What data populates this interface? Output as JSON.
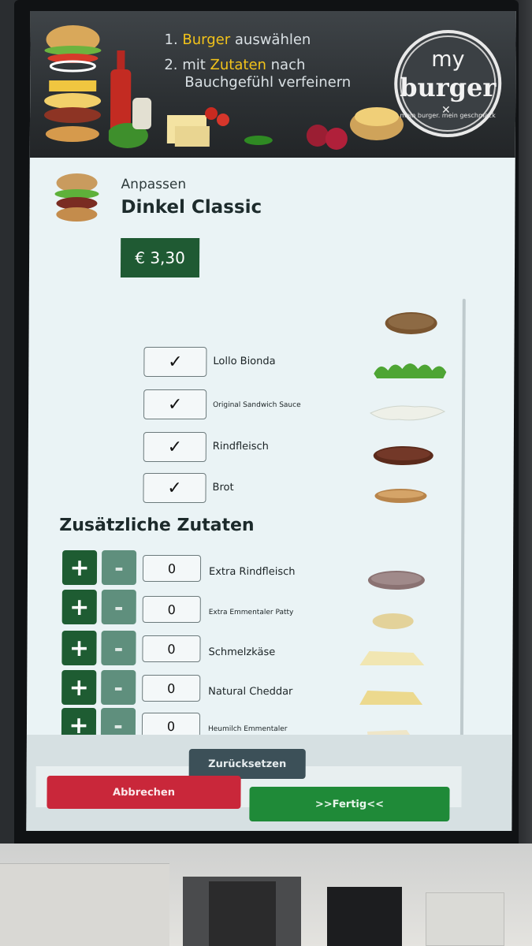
{
  "banner": {
    "step1_prefix": "1. ",
    "step1_highlight": "Burger",
    "step1_suffix": " auswählen",
    "step2_prefix": "2. mit ",
    "step2_highlight": "Zutaten",
    "step2_suffix": " nach",
    "step2_line2": "Bauchgefühl verfeinern",
    "logo_my": "my",
    "logo_burger": "burger",
    "logo_tagline": "mein burger. mein geschmack"
  },
  "product": {
    "subtitle": "Anpassen",
    "title": "Dinkel Classic",
    "price": "€ 3,30"
  },
  "ingredients": [
    {
      "label": "Lollo Bionda",
      "checked": "✓",
      "icon": "lettuce-icon"
    },
    {
      "label": "Original Sandwich Sauce",
      "checked": "✓",
      "icon": "sauce-icon"
    },
    {
      "label": "Rindfleisch",
      "checked": "✓",
      "icon": "beef-patty-icon"
    },
    {
      "label": "Brot",
      "checked": "✓",
      "icon": "bun-bottom-icon"
    }
  ],
  "extras_heading": "Zusätzliche Zutaten",
  "extras": [
    {
      "label": "Extra Rindfleisch",
      "qty": "0",
      "plus": "+",
      "minus": "-",
      "icon": "patty-icon"
    },
    {
      "label": "Extra Emmentaler Patty",
      "qty": "0",
      "plus": "+",
      "minus": "-",
      "icon": "cheese-patty-icon"
    },
    {
      "label": "Schmelzkäse",
      "qty": "0",
      "plus": "+",
      "minus": "-",
      "icon": "cheese-slice-icon"
    },
    {
      "label": "Natural Cheddar",
      "qty": "0",
      "plus": "+",
      "minus": "-",
      "icon": "cheddar-icon"
    },
    {
      "label": "Heumilch Emmentaler",
      "qty": "0",
      "plus": "+",
      "minus": "-",
      "icon": "emmentaler-icon"
    }
  ],
  "actions": {
    "reset": "Zurücksetzen",
    "cancel": "Abbrechen",
    "done": ">>Fertig<<"
  },
  "colors": {
    "primary_green": "#1e5c32",
    "minus_green": "#5f8f7d",
    "cancel_red": "#c9273a",
    "done_green": "#1f8a38",
    "reset_slate": "#3c5058",
    "highlight_yellow": "#f2c31a"
  }
}
